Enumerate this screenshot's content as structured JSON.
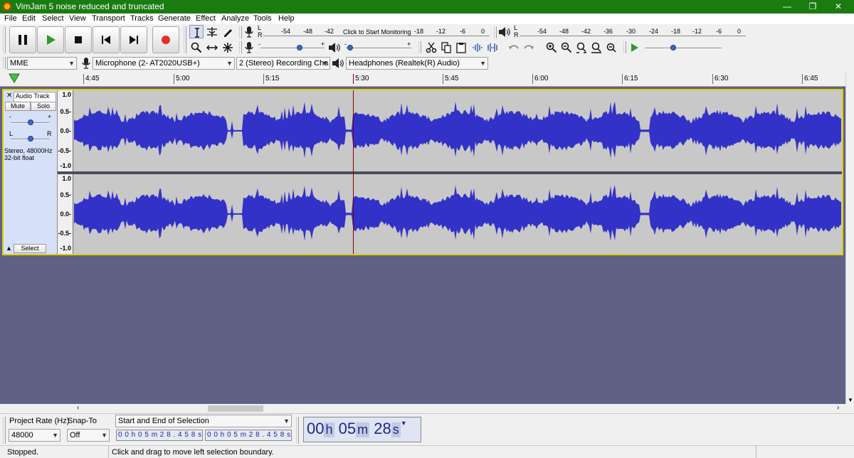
{
  "window": {
    "title": "VimJam 5 noise reduced and truncated",
    "minimize": "—",
    "maximize": "❐",
    "close": "✕"
  },
  "menu": [
    "File",
    "Edit",
    "Select",
    "View",
    "Transport",
    "Tracks",
    "Generate",
    "Effect",
    "Analyze",
    "Tools",
    "Help"
  ],
  "transport": {
    "buttons": [
      {
        "name": "pause-button",
        "icon": "pause-icon"
      },
      {
        "name": "play-button",
        "icon": "play-icon"
      },
      {
        "name": "stop-button",
        "icon": "stop-icon"
      },
      {
        "name": "skip-start-button",
        "icon": "skip-start-icon"
      },
      {
        "name": "skip-end-button",
        "icon": "skip-end-icon"
      },
      {
        "name": "record-button",
        "icon": "record-icon"
      }
    ]
  },
  "meters": {
    "record_scale": [
      "-54",
      "-48",
      "-42",
      "-18",
      "-12",
      "-6",
      "0"
    ],
    "monitor_prompt": "Click to Start Monitoring",
    "playback_scale": [
      "-54",
      "-48",
      "-42",
      "-36",
      "-30",
      "-24",
      "-18",
      "-12",
      "-6",
      "0"
    ],
    "lr_left": "L",
    "lr_right": "R"
  },
  "mixer": {
    "record_volume": 0.62,
    "playback_volume": 0.02,
    "play_speed": 0.36
  },
  "device": {
    "host": "MME",
    "input": "Microphone (2- AT2020USB+)",
    "channels": "2 (Stereo) Recording Cha",
    "output": "Headphones (Realtek(R) Audio)"
  },
  "timeline": {
    "ticks": [
      "4:45",
      "5:00",
      "5:15",
      "5:30",
      "5:45",
      "6:00",
      "6:15",
      "6:30",
      "6:45"
    ]
  },
  "track": {
    "name": "Audio Track",
    "close": "✕",
    "mute": "Mute",
    "solo": "Solo",
    "gain_minus": "-",
    "gain_plus": "+",
    "pan_left": "L",
    "pan_right": "R",
    "gain": 0.5,
    "pan": 0.5,
    "format_line1": "Stereo, 48000Hz",
    "format_line2": "32-bit float",
    "select": "Select",
    "ruler": [
      "1.0",
      "0.5-",
      "0.0-",
      "-0.5-",
      "-1.0"
    ]
  },
  "selection": {
    "rate_label": "Project Rate (Hz)",
    "rate_value": "48000",
    "snap_label": "Snap-To",
    "snap_value": "Off",
    "mode": "Start and End of Selection",
    "start": "0 0 h 0 5 m 2 8 . 4 5 8 s",
    "end": "0 0 h 0 5 m 2 8 . 4 5 8 s",
    "audio_position": {
      "h": "00",
      "m": "05",
      "s": "28"
    }
  },
  "status": {
    "state": "Stopped.",
    "hint": "Click and drag to move left selection boundary."
  },
  "colors": {
    "titlebar": "#1a7b11",
    "waveform": "#3232c8",
    "background": "#5f6285",
    "track_select": "#dfd200"
  }
}
